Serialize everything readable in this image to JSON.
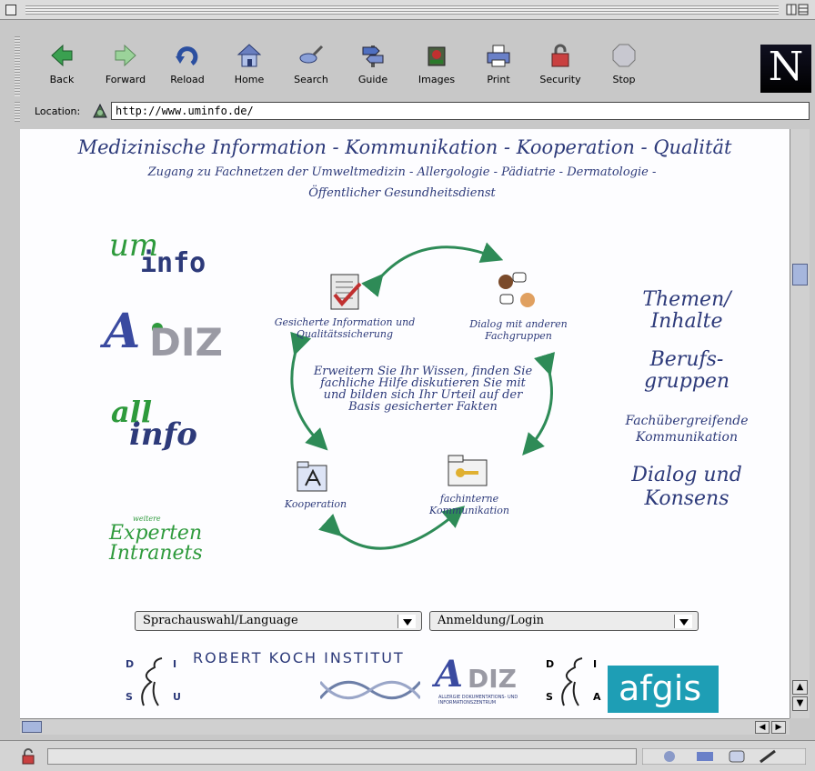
{
  "browser": {
    "toolbar": {
      "back": "Back",
      "forward": "Forward",
      "reload": "Reload",
      "home": "Home",
      "search": "Search",
      "guide": "Guide",
      "images": "Images",
      "print": "Print",
      "security": "Security",
      "stop": "Stop"
    },
    "location_label": "Location:",
    "url": "http://www.uminfo.de/",
    "logo_letter": "N"
  },
  "page": {
    "heading": "Medizinische Information - Kommunikation - Kooperation - Qualität",
    "sub_line1": "Zugang zu Fachnetzen der Umweltmedizin - Allergologie - Pädiatrie - Dermatologie -",
    "sub_line2": "Öffentlicher Gesundheitsdienst",
    "logos": {
      "uminfo_um": "um",
      "uminfo_info": "info",
      "adiz_a": "A",
      "adiz_diz": "DIZ",
      "allinfo_all": "all",
      "allinfo_info": "info",
      "experten_weitere": "weitere",
      "experten_line1": "Experten",
      "experten_line2": "Intranets"
    },
    "cycle": {
      "info": "Gesicherte Information und Qualitätssicherung",
      "dialog": "Dialog mit anderen Fachgruppen",
      "kooperation": "Kooperation",
      "fachintern": "fachinterne Kommunikation",
      "center": "Erweitern Sie Ihr Wissen, finden Sie fachliche Hilfe diskutieren Sie mit und bilden sich Ihr Urteil auf der Basis gesicherter Fakten"
    },
    "right_links": {
      "themen": "Themen/",
      "inhalte": "Inhalte",
      "berufs": "Berufs-",
      "gruppen": "gruppen",
      "fach1": "Fachübergreifende",
      "fach2": "Kommunikation",
      "dialog": "Dialog und",
      "konsens": "Konsens"
    },
    "selects": {
      "language": "Sprachauswahl/Language",
      "login": "Anmeldung/Login"
    },
    "partners": {
      "rki": "ROBERT KOCH INSTITUT",
      "afgis": "afgis",
      "dsiu": [
        "D",
        "I",
        "S",
        "U"
      ],
      "dsia": [
        "D",
        "I",
        "S",
        "A"
      ],
      "adiz_small": "ALLERGIE DOKUMENTATIONS- UND INFORMATIONSZENTRUM"
    }
  },
  "colors": {
    "brand_blue": "#2d3a7a",
    "brand_green": "#2e9a3c",
    "arrow_green": "#2e8b57",
    "afgis_teal": "#1e9eb5"
  }
}
